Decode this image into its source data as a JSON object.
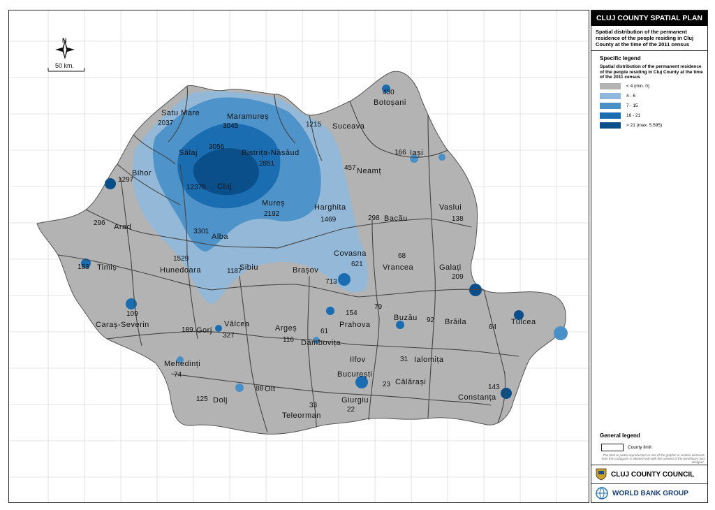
{
  "title_block": {
    "title": "CLUJ COUNTY SPATIAL PLAN",
    "subtitle": "Spatial distribution of the permanent residence of the people residing in Cluj County at the time of the 2011 census"
  },
  "legend": {
    "heading": "Specific legend",
    "subheading": "Spatial distribution of the permanent residence of the people residing in Cluj County at the time of the 2011 census",
    "classes": [
      {
        "label": "< 4 (min. 0)",
        "color": "#b3b3b3"
      },
      {
        "label": "4 - 6",
        "color": "#8fb8dc"
      },
      {
        "label": "7 - 15",
        "color": "#4a90c8"
      },
      {
        "label": "16 - 21",
        "color": "#1a6db0"
      },
      {
        "label": "> 21 (max. 5.595)",
        "color": "#0a4f8a"
      }
    ]
  },
  "general_legend": {
    "heading": "General legend",
    "county_limit": "County limit",
    "disclaimer": "The total or partial reproduction or use of the graphic or content elements from this cartogram is allowed only with the consent of the beneficiary and designer."
  },
  "logos": {
    "council": "CLUJ COUNTY COUNCIL",
    "bank": "WORLD BANK GROUP"
  },
  "scale": "50 km.",
  "north": "N",
  "counties": [
    {
      "name": "Satu Mare",
      "value": "2037"
    },
    {
      "name": "Maramureș",
      "value": "3045"
    },
    {
      "name": "Suceava",
      "value": "1215"
    },
    {
      "name": "Botoșani",
      "value": "430"
    },
    {
      "name": "Sălaj",
      "value": "3056"
    },
    {
      "name": "Bistrița-Năsăud",
      "value": "2851"
    },
    {
      "name": "Iași",
      "value": "166"
    },
    {
      "name": "Bihor",
      "value": "1297"
    },
    {
      "name": "Cluj",
      "value": "12376"
    },
    {
      "name": "Neamț",
      "value": "457"
    },
    {
      "name": "Mureș",
      "value": "2192"
    },
    {
      "name": "Harghita",
      "value": "1469"
    },
    {
      "name": "Vaslui",
      "value": "138"
    },
    {
      "name": "Arad",
      "value": "296"
    },
    {
      "name": "Alba",
      "value": "3301"
    },
    {
      "name": "Bacău",
      "value": "298"
    },
    {
      "name": "Timiș",
      "value": "183"
    },
    {
      "name": "Hunedoara",
      "value": "1529"
    },
    {
      "name": "Sibiu",
      "value": "1187"
    },
    {
      "name": "Covasna",
      "value": "621"
    },
    {
      "name": "Brașov",
      "value": "713"
    },
    {
      "name": "Vrancea",
      "value": "68"
    },
    {
      "name": "Galați",
      "value": "209"
    },
    {
      "name": "Caraș-Severin",
      "value": "109"
    },
    {
      "name": "Gorj",
      "value": "189"
    },
    {
      "name": "Vâlcea",
      "value": "327"
    },
    {
      "name": "Argeș",
      "value": "116"
    },
    {
      "name": "Prahova",
      "value": "154"
    },
    {
      "name": "Buzău",
      "value": "79"
    },
    {
      "name": "Brăila",
      "value": "92"
    },
    {
      "name": "Tulcea",
      "value": "64"
    },
    {
      "name": "Dâmbovița",
      "value": "61"
    },
    {
      "name": "Mehedinți",
      "value": "74"
    },
    {
      "name": "Ilfov",
      "value": ""
    },
    {
      "name": "Ialomița",
      "value": "31"
    },
    {
      "name": "București",
      "value": ""
    },
    {
      "name": "Olt",
      "value": "88"
    },
    {
      "name": "Dolj",
      "value": "125"
    },
    {
      "name": "Călărași",
      "value": "23"
    },
    {
      "name": "Constanța",
      "value": "143"
    },
    {
      "name": "Teleorman",
      "value": "33"
    },
    {
      "name": "Giurgiu",
      "value": "22"
    }
  ]
}
